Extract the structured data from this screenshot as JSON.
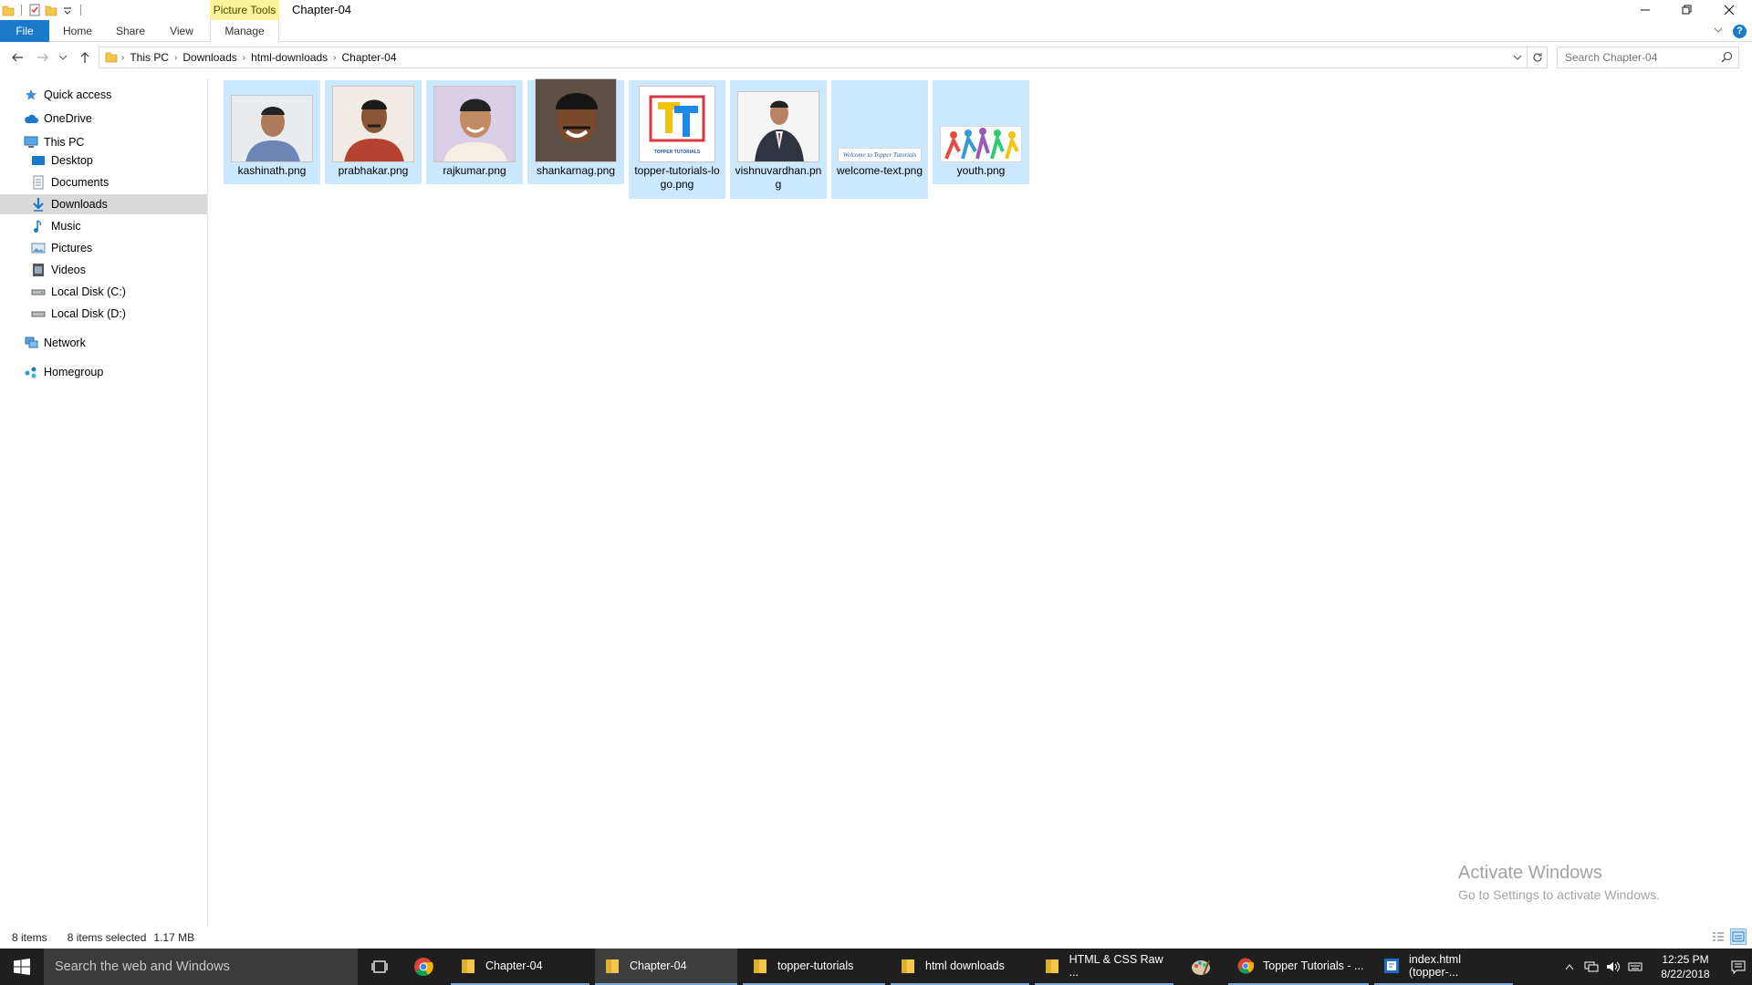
{
  "window": {
    "title": "Chapter-04",
    "contextual_tab_group": "Picture Tools",
    "minimize_icon": "minimize-icon",
    "maximize_icon": "restore-icon",
    "close_icon": "close-icon"
  },
  "ribbon": {
    "tabs": [
      {
        "label": "File"
      },
      {
        "label": "Home"
      },
      {
        "label": "Share"
      },
      {
        "label": "View"
      },
      {
        "label": "Manage"
      }
    ],
    "help_label": "?"
  },
  "address_bar": {
    "crumbs": [
      "This PC",
      "Downloads",
      "html-downloads",
      "Chapter-04"
    ]
  },
  "search": {
    "placeholder": "Search Chapter-04"
  },
  "sidebar": {
    "items": [
      {
        "label": "Quick access",
        "icon": "star-icon",
        "indent": 0
      },
      {
        "label": "OneDrive",
        "icon": "cloud-icon",
        "indent": 0
      },
      {
        "label": "This PC",
        "icon": "computer-icon",
        "indent": 0
      },
      {
        "label": "Desktop",
        "icon": "desktop-icon",
        "indent": 1
      },
      {
        "label": "Documents",
        "icon": "documents-icon",
        "indent": 1
      },
      {
        "label": "Downloads",
        "icon": "download-icon",
        "indent": 1,
        "selected": true
      },
      {
        "label": "Music",
        "icon": "music-icon",
        "indent": 1
      },
      {
        "label": "Pictures",
        "icon": "pictures-icon",
        "indent": 1
      },
      {
        "label": "Videos",
        "icon": "videos-icon",
        "indent": 1
      },
      {
        "label": "Local Disk (C:)",
        "icon": "drive-icon",
        "indent": 1
      },
      {
        "label": "Local Disk (D:)",
        "icon": "drive-icon",
        "indent": 1
      },
      {
        "label": "Network",
        "icon": "network-icon",
        "indent": 0
      },
      {
        "label": "Homegroup",
        "icon": "homegroup-icon",
        "indent": 0
      }
    ]
  },
  "files": [
    {
      "name": "kashinath.png"
    },
    {
      "name": "prabhakar.png"
    },
    {
      "name": "rajkumar.png"
    },
    {
      "name": "shankarnag.png"
    },
    {
      "name": "topper-tutorials-logo.png",
      "logo_text": "TOPPER TUTORIALS"
    },
    {
      "name": "vishnuvardhan.png"
    },
    {
      "name": "welcome-text.png",
      "thumb_text": "Welcome to Topper Tutorials"
    },
    {
      "name": "youth.png"
    }
  ],
  "status": {
    "item_count": "8 items",
    "selection": "8 items selected",
    "size": "1.17 MB"
  },
  "watermark": {
    "line1": "Activate Windows",
    "line2": "Go to Settings to activate Windows."
  },
  "taskbar": {
    "search_placeholder": "Search the web and Windows",
    "apps": [
      {
        "label": "Chapter-04",
        "icon": "folder-icon"
      },
      {
        "label": "Chapter-04",
        "icon": "folder-icon",
        "active": true
      },
      {
        "label": "topper-tutorials",
        "icon": "folder-icon"
      },
      {
        "label": "html downloads",
        "icon": "folder-icon"
      },
      {
        "label": "HTML & CSS Raw ...",
        "icon": "folder-icon"
      },
      {
        "label": "Topper Tutorials - ...",
        "icon": "chrome-icon"
      },
      {
        "label": "index.html (topper-...",
        "icon": "editor-icon"
      }
    ],
    "clock_time": "12:25 PM",
    "clock_date": "8/22/2018"
  },
  "colors": {
    "accent": "#1979ca",
    "selection": "#cce8ff",
    "context_tab": "#fbf39c",
    "taskbar": "#1f1f1f"
  }
}
